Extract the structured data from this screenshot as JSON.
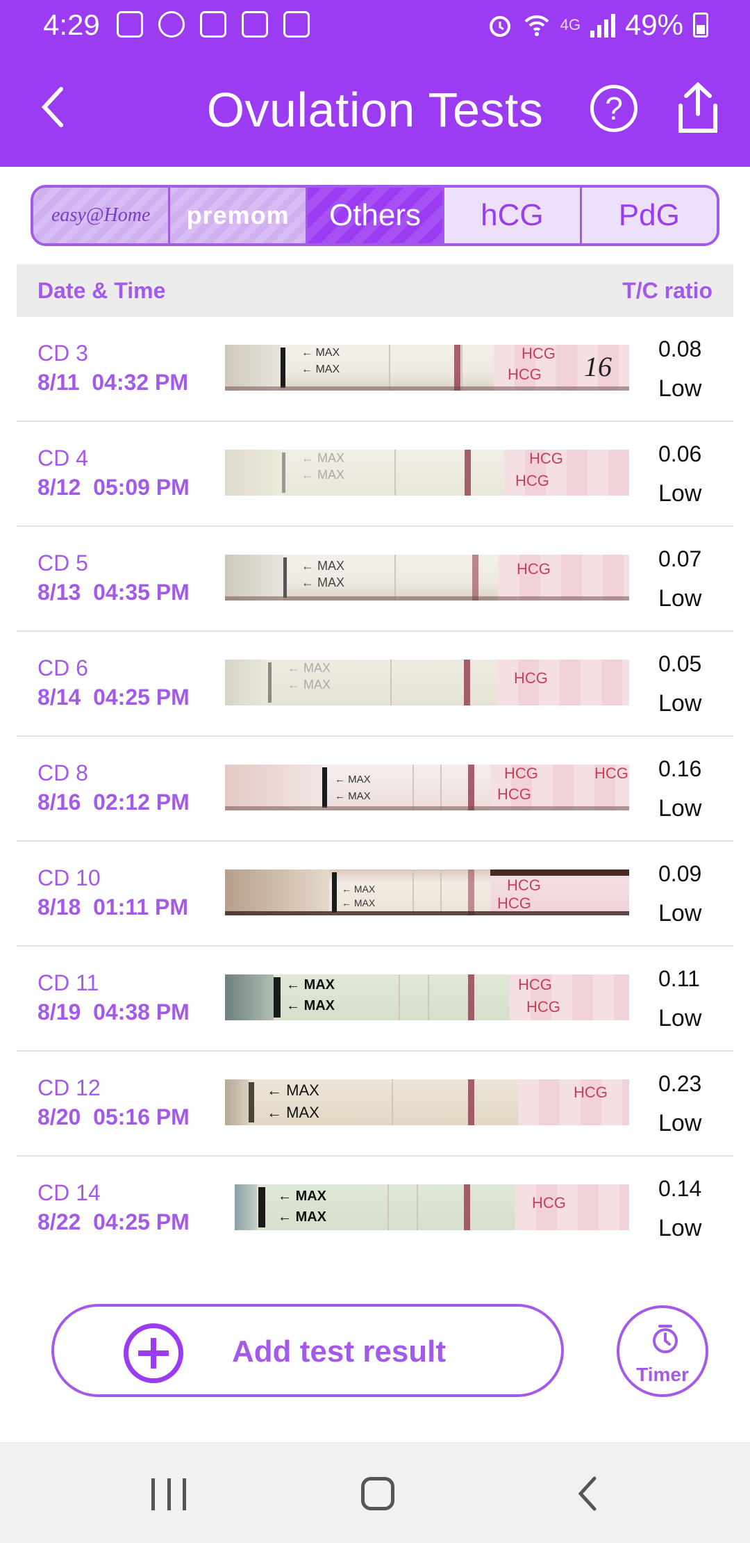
{
  "status_bar": {
    "time": "4:29",
    "battery": "49%",
    "network": "4G"
  },
  "header": {
    "title": "Ovulation Tests"
  },
  "tabs": [
    {
      "label": "easy@Home",
      "kind": "brand"
    },
    {
      "label": "premom",
      "kind": "brand"
    },
    {
      "label": "Others",
      "kind": "active"
    },
    {
      "label": "hCG",
      "kind": "normal"
    },
    {
      "label": "PdG",
      "kind": "normal"
    }
  ],
  "table": {
    "col_date": "Date & Time",
    "col_ratio": "T/C ratio",
    "rows": [
      {
        "cd": "CD 3",
        "date": "8/11",
        "time": "04:32 PM",
        "ratio": "0.08",
        "level": "Low"
      },
      {
        "cd": "CD 4",
        "date": "8/12",
        "time": "05:09 PM",
        "ratio": "0.06",
        "level": "Low"
      },
      {
        "cd": "CD 5",
        "date": "8/13",
        "time": "04:35 PM",
        "ratio": "0.07",
        "level": "Low"
      },
      {
        "cd": "CD 6",
        "date": "8/14",
        "time": "04:25 PM",
        "ratio": "0.05",
        "level": "Low"
      },
      {
        "cd": "CD 8",
        "date": "8/16",
        "time": "02:12 PM",
        "ratio": "0.16",
        "level": "Low"
      },
      {
        "cd": "CD 10",
        "date": "8/18",
        "time": "01:11 PM",
        "ratio": "0.09",
        "level": "Low"
      },
      {
        "cd": "CD 11",
        "date": "8/19",
        "time": "04:38 PM",
        "ratio": "0.11",
        "level": "Low"
      },
      {
        "cd": "CD 12",
        "date": "8/20",
        "time": "05:16 PM",
        "ratio": "0.23",
        "level": "Low"
      },
      {
        "cd": "CD 14",
        "date": "8/22",
        "time": "04:25 PM",
        "ratio": "0.14",
        "level": "Low"
      }
    ]
  },
  "strip": {
    "max_label": "MAX",
    "brand_text": "HCG"
  },
  "actions": {
    "add_label": "Add test result",
    "timer_label": "Timer"
  },
  "colors": {
    "primary": "#9b3cf2",
    "accent_text": "#a35ae8",
    "header_bg": "#ececec"
  }
}
